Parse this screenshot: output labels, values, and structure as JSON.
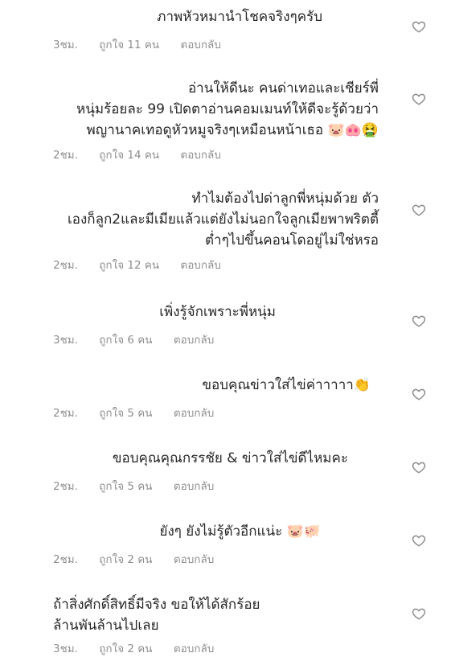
{
  "comments": [
    {
      "text": "ภาพหัวหมานำโชคจริงๆครับ",
      "time": "3ชม.",
      "likes": "ถูกใจ 11 คน",
      "reply": "ตอบกลับ"
    },
    {
      "text": "อ่านให้ดีนะ คนด่าเทอและเชียร์พี่\nหนุ่มร้อยละ 99 เปิดตาอ่านคอมเมนท์ให้ดีจะรู้ด้วยว่า\nพญานาคเทอดูหัวหมูจริงๆเหมือนหน้าเธอ 🐷🐽🤮",
      "time": "2ชม.",
      "likes": "ถูกใจ 14 คน",
      "reply": "ตอบกลับ"
    },
    {
      "text": "ทำไมต้องไปด่าลูกพี่หนุ่มด้วย ตัว\nเองก็ลูก2และมีเมียแล้วแต่ยังไม่นอกใจลูกเมียพาพริตตี้\nต่ำๆไปขึ้นคอนโดอยู่ไม่ใช่หรอ",
      "time": "2ชม.",
      "likes": "ถูกใจ 12 คน",
      "reply": "ตอบกลับ"
    },
    {
      "text": "เพิ่งรู้จักเพราะพี่หนุ่ม",
      "time": "3ชม.",
      "likes": "ถูกใจ 6 คน",
      "reply": "ตอบกลับ"
    },
    {
      "text": "ขอบคุณข่าวใส่ไข่ค่าาาาา👏",
      "time": "2ชม.",
      "likes": "ถูกใจ 5 คน",
      "reply": "ตอบกลับ"
    },
    {
      "text": "ขอบคุณคุณกรรชัย & ข่าวใส่ไข่ดีไหมคะ",
      "time": "2ชม.",
      "likes": "ถูกใจ 5 คน",
      "reply": "ตอบกลับ"
    },
    {
      "text": "ยังๆ ยังไม่รู้ตัวอีกแน่ะ 🐷🐖",
      "time": "2ชม.",
      "likes": "ถูกใจ 2 คน",
      "reply": "ตอบกลับ"
    },
    {
      "text": "ถ้าสิ่งศักดิ์สิทธิ์มีจริง ขอให้ได้สักร้อย\nล้านพันล้านไปเลย",
      "time": "3ชม.",
      "likes": "ถูกใจ 2 คน",
      "reply": "ตอบกลับ"
    }
  ],
  "icons": {
    "like": "heart-outline-icon"
  },
  "colors": {
    "text": "#262626",
    "meta": "#8e8e8e"
  }
}
